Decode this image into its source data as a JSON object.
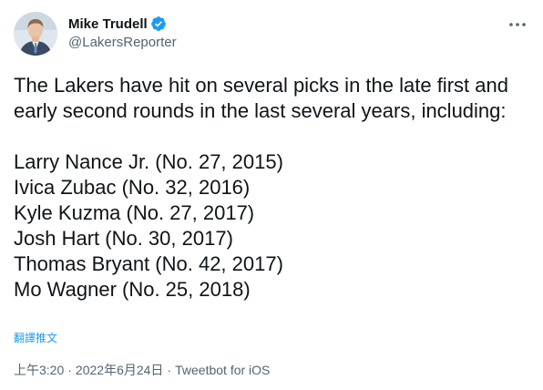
{
  "author": {
    "display_name": "Mike Trudell",
    "handle": "@LakersReporter",
    "verified": true
  },
  "menu_icon": "more-horizontal-icon",
  "tweet": {
    "intro": "The Lakers have hit on several picks in the late first and early second rounds in the last several years, including:",
    "list": [
      "Larry Nance Jr. (No. 27, 2015)",
      "Ivica Zubac (No. 32, 2016)",
      "Kyle Kuzma (No. 27, 2017)",
      "Josh Hart (No. 30, 2017)",
      "Thomas Bryant (No. 42, 2017)",
      "Mo Wagner (No. 25, 2018)"
    ],
    "translate_label": "翻譯推文"
  },
  "meta": {
    "time": "上午3:20",
    "separator": "·",
    "date": "2022年6月24日",
    "source": "Tweetbot for iOS"
  },
  "colors": {
    "text": "#0f1419",
    "secondary": "#536471",
    "accent": "#1d9bf0"
  }
}
